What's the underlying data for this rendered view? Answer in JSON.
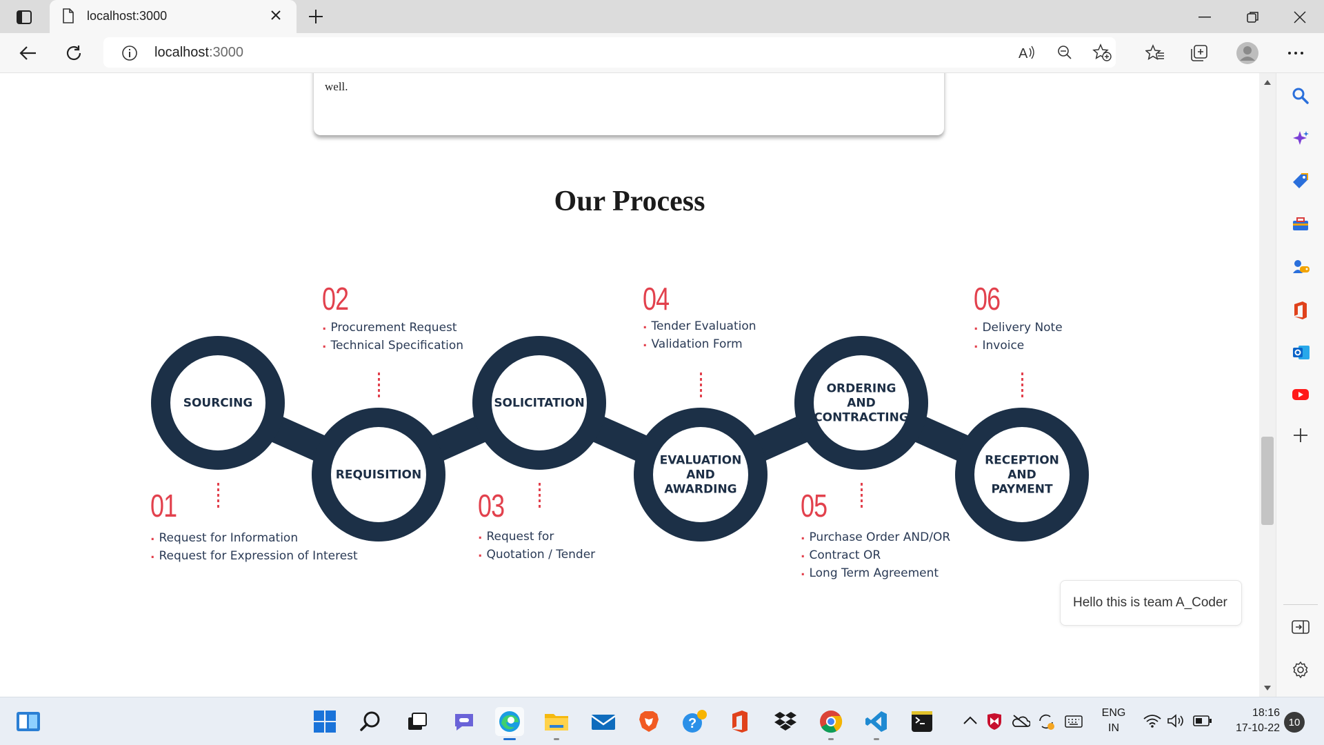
{
  "browser": {
    "tab_title": "localhost:3000",
    "url_host": "localhost",
    "url_port": ":3000"
  },
  "page": {
    "prev_card_text": "well.",
    "section_title": "Our Process",
    "steps": [
      {
        "number": "01",
        "circle_label": "SOURCING",
        "items": [
          "Request for Information",
          "Request for Expression of Interest"
        ]
      },
      {
        "number": "02",
        "circle_label": "REQUISITION",
        "items": [
          "Procurement Request",
          "Technical Specification"
        ]
      },
      {
        "number": "03",
        "circle_label": "SOLICITATION",
        "items": [
          "Request for",
          "Quotation / Tender"
        ]
      },
      {
        "number": "04",
        "circle_label": "EVALUATION AND AWARDING",
        "circle_lines": [
          "EVALUATION",
          "AND",
          "AWARDING"
        ],
        "items": [
          "Tender Evaluation",
          "Validation Form"
        ]
      },
      {
        "number": "05",
        "circle_label": "ORDERING AND CONTRACTING",
        "circle_lines": [
          "ORDERING",
          "AND",
          "CONTRACTING"
        ],
        "items": [
          "Purchase Order AND/OR",
          "Contract OR",
          "Long Term Agreement"
        ]
      },
      {
        "number": "06",
        "circle_label": "RECEPTION AND PAYMENT",
        "circle_lines": [
          "RECEPTION",
          "AND",
          "PAYMENT"
        ],
        "items": [
          "Delivery Note",
          "Invoice"
        ]
      }
    ],
    "colors": {
      "ring": "#1c3047",
      "accent": "#e2414d",
      "text": "#2a3a55"
    }
  },
  "chat": {
    "message": "Hello this is team A_Coder"
  },
  "sidebar_icons": [
    "search-icon",
    "copilot-icon",
    "shopping-tag-icon",
    "tools-icon",
    "games-icon",
    "office-icon",
    "outlook-icon",
    "youtube-icon",
    "add-icon",
    "split-screen-icon",
    "settings-icon"
  ],
  "taskbar": {
    "language": "ENG",
    "region": "IN",
    "time": "18:16",
    "date": "17-10-22",
    "notification_count": "10"
  }
}
